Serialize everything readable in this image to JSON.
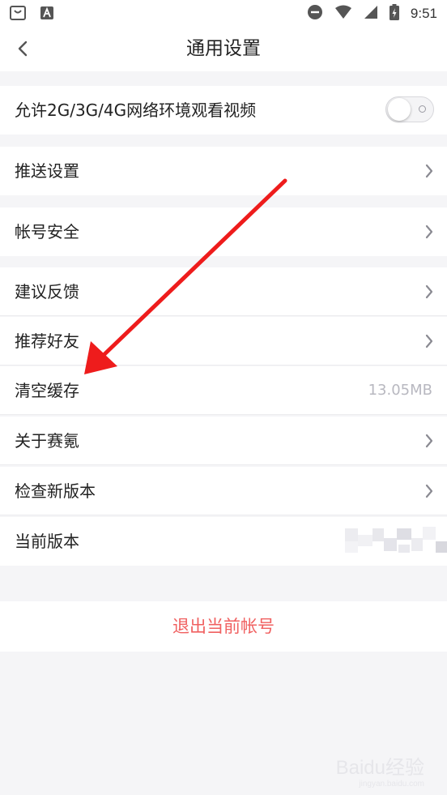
{
  "status_bar": {
    "time": "9:51"
  },
  "nav": {
    "title": "通用设置"
  },
  "rows": {
    "allow_mobile_video": "允许2G/3G/4G网络环境观看视频",
    "push_settings": "推送设置",
    "account_security": "帐号安全",
    "feedback": "建议反馈",
    "recommend_friends": "推荐好友",
    "clear_cache": "清空缓存",
    "clear_cache_value": "13.05MB",
    "about": "关于赛氪",
    "check_update": "检查新版本",
    "current_version": "当前版本"
  },
  "toggle_allow_mobile_video": false,
  "logout": {
    "label": "退出当前帐号"
  },
  "watermark": {
    "main": "Baidu经验",
    "sub": "jingyan.baidu.com"
  },
  "colors": {
    "accent_red": "#f06060",
    "arrow": "#ee1c1c",
    "bg": "#f5f5f7"
  }
}
